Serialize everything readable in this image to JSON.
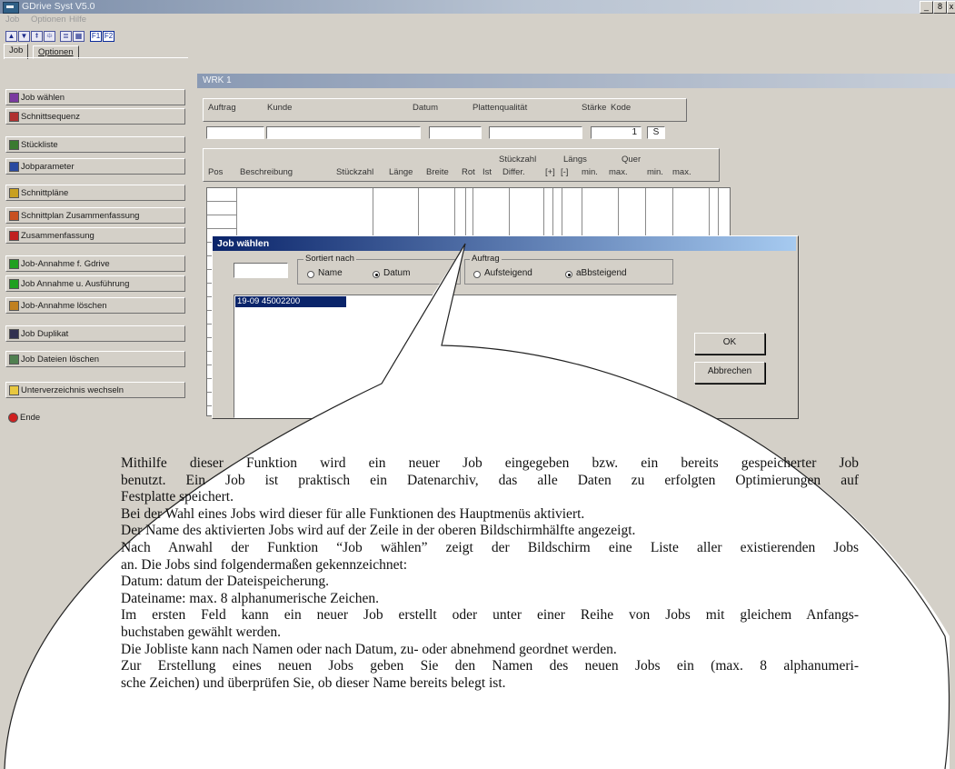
{
  "window": {
    "title": "GDrive Syst V5.0",
    "controls": [
      "_",
      "8",
      "x"
    ]
  },
  "menu": {
    "items": [
      "Job",
      "Optionen",
      "Hilfe"
    ]
  },
  "toolbar": {
    "f1": "F1",
    "f2": "F2"
  },
  "left_tabs": [
    "Job",
    "Optionen"
  ],
  "left_buttons": [
    {
      "label": "Job wählen",
      "icon": "job-select-icon",
      "color": "#7a3aa0"
    },
    {
      "label": "Schnittsequenz",
      "icon": "cut-sequence-icon",
      "color": "#b03030"
    },
    {
      "label": "Stückliste",
      "icon": "parts-list-icon",
      "color": "#3a7a30"
    },
    {
      "label": "Jobparameter",
      "icon": "job-parameter-icon",
      "color": "#2a4aa0"
    },
    {
      "label": "Schnittpläne",
      "icon": "cut-plans-icon",
      "color": "#c8a020"
    },
    {
      "label": "Schnittplan Zusammenfassung",
      "icon": "cut-plan-summary-icon",
      "color": "#c85020"
    },
    {
      "label": "Zusammenfassung",
      "icon": "sigma-icon",
      "color": "#c02020"
    },
    {
      "label": "Job-Annahme f. Gdrive",
      "icon": "ok-icon",
      "color": "#20a020"
    },
    {
      "label": "Job Annahme u. Ausführung",
      "icon": "ok-run-icon",
      "color": "#20a020"
    },
    {
      "label": "Job-Annahme löschen",
      "icon": "delete-acceptance-icon",
      "color": "#c08020"
    },
    {
      "label": "Job Duplikat",
      "icon": "floppy-icon",
      "color": "#303050"
    },
    {
      "label": "Job Dateien löschen",
      "icon": "trash-icon",
      "color": "#508050"
    },
    {
      "label": "Unterverzeichnis wechseln",
      "icon": "folder-icon",
      "color": "#e8c840"
    },
    {
      "label": "Ende",
      "icon": "stop-icon",
      "color": "#d02020"
    }
  ],
  "work": {
    "title": "WRK  1",
    "header_labels": {
      "auftrag": "Auftrag",
      "kunde": "Kunde",
      "datum": "Datum",
      "platten": "Plattenqualität",
      "staerke": "Stärke",
      "kode": "Kode"
    },
    "staerke_value": "1",
    "kode_value": "S",
    "columns": {
      "pos": "Pos",
      "beschreibung": "Beschreibung",
      "stueckzahl": "Stückzahl",
      "laenge": "Länge",
      "breite": "Breite",
      "rot": "Rot",
      "stueckzahl2": "Stückzahl",
      "ist": "Ist",
      "differ": "Differ.",
      "laengs": "Längs",
      "plus": "[+]",
      "minus": "[-]",
      "min1": "min.",
      "max1": "max.",
      "quer": "Quer",
      "min2": "min.",
      "max2": "max."
    }
  },
  "dialog": {
    "title": "Job wählen",
    "sort_group": "Sortiert nach",
    "sort_name": "Name",
    "sort_datum": "Datum",
    "order_group": "Auftrag",
    "order_asc": "Aufsteigend",
    "order_desc": "aBbsteigend",
    "list_item": "19-09  45002200",
    "ok": "OK",
    "cancel": "Abbrechen"
  },
  "callout": {
    "lines": [
      "Mithilfe dieser Funktion wird ein neuer Job eingegeben bzw. ein bereits gespeicherter Job",
      "benutzt. Ein Job ist praktisch ein Datenarchiv, das alle Daten zu erfolgten Optimierungen auf",
      "Festplatte speichert.",
      "Bei der Wahl eines Jobs wird dieser für alle Funktionen des Hauptmenüs aktiviert.",
      "Der Name des aktivierten Jobs wird auf der Zeile in der oberen Bildschirmhälfte angezeigt.",
      "Nach Anwahl der Funktion “Job wählen” zeigt der Bildschirm eine Liste aller existierenden Jobs",
      "an. Die Jobs sind folgendermaßen gekennzeichnet:",
      "Datum: datum der Dateispeicherung.",
      "Dateiname: max. 8 alphanumerische Zeichen.",
      "Im ersten Feld kann ein neuer Job erstellt oder unter einer Reihe von Jobs mit gleichem Anfangs-",
      "buchstaben gewählt werden.",
      "Die Jobliste kann nach Namen oder nach Datum, zu- oder abnehmend geordnet werden.",
      "Zur Erstellung eines neuen Jobs geben Sie den Namen des neuen Jobs ein (max. 8 alphanumeri-",
      "sche Zeichen) und überprüfen Sie, ob dieser Name bereits belegt ist."
    ]
  }
}
